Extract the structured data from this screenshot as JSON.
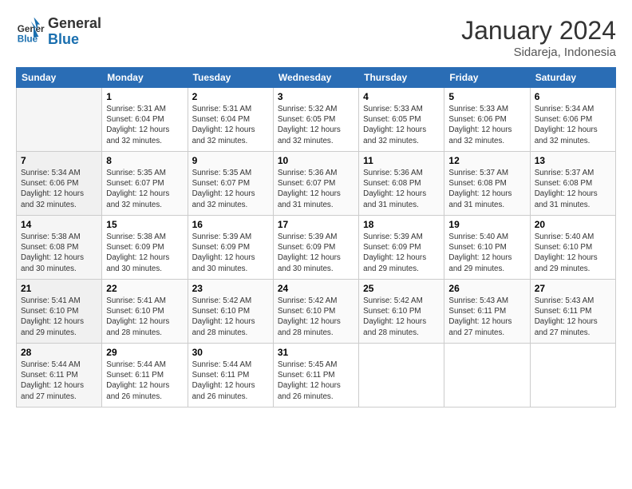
{
  "header": {
    "logo_line1": "General",
    "logo_line2": "Blue",
    "month_title": "January 2024",
    "subtitle": "Sidareja, Indonesia"
  },
  "weekdays": [
    "Sunday",
    "Monday",
    "Tuesday",
    "Wednesday",
    "Thursday",
    "Friday",
    "Saturday"
  ],
  "weeks": [
    [
      {
        "day": "",
        "info": ""
      },
      {
        "day": "1",
        "info": "Sunrise: 5:31 AM\nSunset: 6:04 PM\nDaylight: 12 hours\nand 32 minutes."
      },
      {
        "day": "2",
        "info": "Sunrise: 5:31 AM\nSunset: 6:04 PM\nDaylight: 12 hours\nand 32 minutes."
      },
      {
        "day": "3",
        "info": "Sunrise: 5:32 AM\nSunset: 6:05 PM\nDaylight: 12 hours\nand 32 minutes."
      },
      {
        "day": "4",
        "info": "Sunrise: 5:33 AM\nSunset: 6:05 PM\nDaylight: 12 hours\nand 32 minutes."
      },
      {
        "day": "5",
        "info": "Sunrise: 5:33 AM\nSunset: 6:06 PM\nDaylight: 12 hours\nand 32 minutes."
      },
      {
        "day": "6",
        "info": "Sunrise: 5:34 AM\nSunset: 6:06 PM\nDaylight: 12 hours\nand 32 minutes."
      }
    ],
    [
      {
        "day": "7",
        "info": "Sunrise: 5:34 AM\nSunset: 6:06 PM\nDaylight: 12 hours\nand 32 minutes."
      },
      {
        "day": "8",
        "info": "Sunrise: 5:35 AM\nSunset: 6:07 PM\nDaylight: 12 hours\nand 32 minutes."
      },
      {
        "day": "9",
        "info": "Sunrise: 5:35 AM\nSunset: 6:07 PM\nDaylight: 12 hours\nand 32 minutes."
      },
      {
        "day": "10",
        "info": "Sunrise: 5:36 AM\nSunset: 6:07 PM\nDaylight: 12 hours\nand 31 minutes."
      },
      {
        "day": "11",
        "info": "Sunrise: 5:36 AM\nSunset: 6:08 PM\nDaylight: 12 hours\nand 31 minutes."
      },
      {
        "day": "12",
        "info": "Sunrise: 5:37 AM\nSunset: 6:08 PM\nDaylight: 12 hours\nand 31 minutes."
      },
      {
        "day": "13",
        "info": "Sunrise: 5:37 AM\nSunset: 6:08 PM\nDaylight: 12 hours\nand 31 minutes."
      }
    ],
    [
      {
        "day": "14",
        "info": "Sunrise: 5:38 AM\nSunset: 6:08 PM\nDaylight: 12 hours\nand 30 minutes."
      },
      {
        "day": "15",
        "info": "Sunrise: 5:38 AM\nSunset: 6:09 PM\nDaylight: 12 hours\nand 30 minutes."
      },
      {
        "day": "16",
        "info": "Sunrise: 5:39 AM\nSunset: 6:09 PM\nDaylight: 12 hours\nand 30 minutes."
      },
      {
        "day": "17",
        "info": "Sunrise: 5:39 AM\nSunset: 6:09 PM\nDaylight: 12 hours\nand 30 minutes."
      },
      {
        "day": "18",
        "info": "Sunrise: 5:39 AM\nSunset: 6:09 PM\nDaylight: 12 hours\nand 29 minutes."
      },
      {
        "day": "19",
        "info": "Sunrise: 5:40 AM\nSunset: 6:10 PM\nDaylight: 12 hours\nand 29 minutes."
      },
      {
        "day": "20",
        "info": "Sunrise: 5:40 AM\nSunset: 6:10 PM\nDaylight: 12 hours\nand 29 minutes."
      }
    ],
    [
      {
        "day": "21",
        "info": "Sunrise: 5:41 AM\nSunset: 6:10 PM\nDaylight: 12 hours\nand 29 minutes."
      },
      {
        "day": "22",
        "info": "Sunrise: 5:41 AM\nSunset: 6:10 PM\nDaylight: 12 hours\nand 28 minutes."
      },
      {
        "day": "23",
        "info": "Sunrise: 5:42 AM\nSunset: 6:10 PM\nDaylight: 12 hours\nand 28 minutes."
      },
      {
        "day": "24",
        "info": "Sunrise: 5:42 AM\nSunset: 6:10 PM\nDaylight: 12 hours\nand 28 minutes."
      },
      {
        "day": "25",
        "info": "Sunrise: 5:42 AM\nSunset: 6:10 PM\nDaylight: 12 hours\nand 28 minutes."
      },
      {
        "day": "26",
        "info": "Sunrise: 5:43 AM\nSunset: 6:11 PM\nDaylight: 12 hours\nand 27 minutes."
      },
      {
        "day": "27",
        "info": "Sunrise: 5:43 AM\nSunset: 6:11 PM\nDaylight: 12 hours\nand 27 minutes."
      }
    ],
    [
      {
        "day": "28",
        "info": "Sunrise: 5:44 AM\nSunset: 6:11 PM\nDaylight: 12 hours\nand 27 minutes."
      },
      {
        "day": "29",
        "info": "Sunrise: 5:44 AM\nSunset: 6:11 PM\nDaylight: 12 hours\nand 26 minutes."
      },
      {
        "day": "30",
        "info": "Sunrise: 5:44 AM\nSunset: 6:11 PM\nDaylight: 12 hours\nand 26 minutes."
      },
      {
        "day": "31",
        "info": "Sunrise: 5:45 AM\nSunset: 6:11 PM\nDaylight: 12 hours\nand 26 minutes."
      },
      {
        "day": "",
        "info": ""
      },
      {
        "day": "",
        "info": ""
      },
      {
        "day": "",
        "info": ""
      }
    ]
  ]
}
